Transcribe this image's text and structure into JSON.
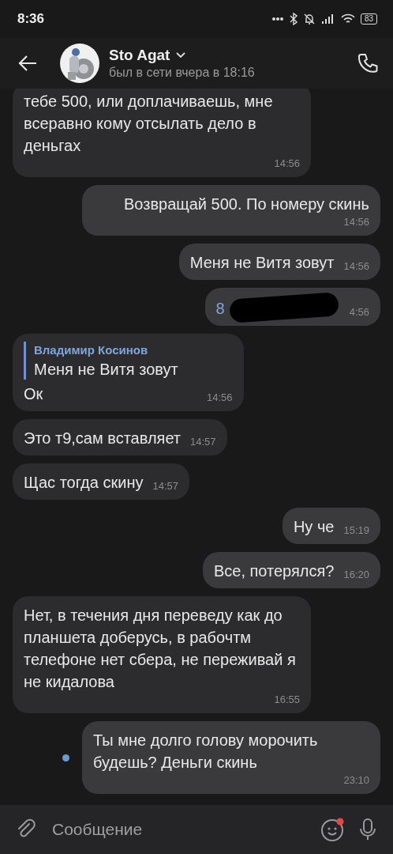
{
  "status_bar": {
    "time": "8:36",
    "battery": "83"
  },
  "header": {
    "name": "Sto Agat",
    "last_seen": "был в сети вчера в 18:16"
  },
  "messages": [
    {
      "kind": "incoming",
      "text": "тебе 500, или доплачиваешь, мне всеравно кому отсылать дело  в деньгах",
      "time": "14:56"
    },
    {
      "kind": "outgoing",
      "text": "Возвращай 500. По номеру скинь",
      "time": "14:56",
      "unread": false
    },
    {
      "kind": "outgoing",
      "text": "Меня не Витя зовут",
      "time": "14:56",
      "unread": false
    },
    {
      "kind": "redacted",
      "text": "8",
      "time": "4:56",
      "unread": false
    },
    {
      "kind": "incoming",
      "reply": {
        "author": "Владимир Косинов",
        "text": "Меня не Витя зовут"
      },
      "text": "Ок",
      "time": "14:56"
    },
    {
      "kind": "incoming",
      "text": "Это т9,сам вставляет",
      "time": "14:57"
    },
    {
      "kind": "incoming",
      "text": "Щас тогда скину",
      "time": "14:57"
    },
    {
      "kind": "outgoing",
      "text": "Ну че",
      "time": "15:19",
      "unread": false
    },
    {
      "kind": "outgoing",
      "text": "Все, потерялся?",
      "time": "16:20",
      "unread": false
    },
    {
      "kind": "incoming",
      "text": "Нет,  в течения дня переведу как до планшета доберусь, в рабочтм телефоне нет сбера, не переживай я не кидалова",
      "time": "16:55"
    },
    {
      "kind": "outgoing",
      "text": "Ты мне долго голову морочить будешь? Деньги скинь",
      "time": "23:10",
      "unread": true
    }
  ],
  "composer": {
    "placeholder": "Сообщение",
    "emoji_badge": true
  }
}
